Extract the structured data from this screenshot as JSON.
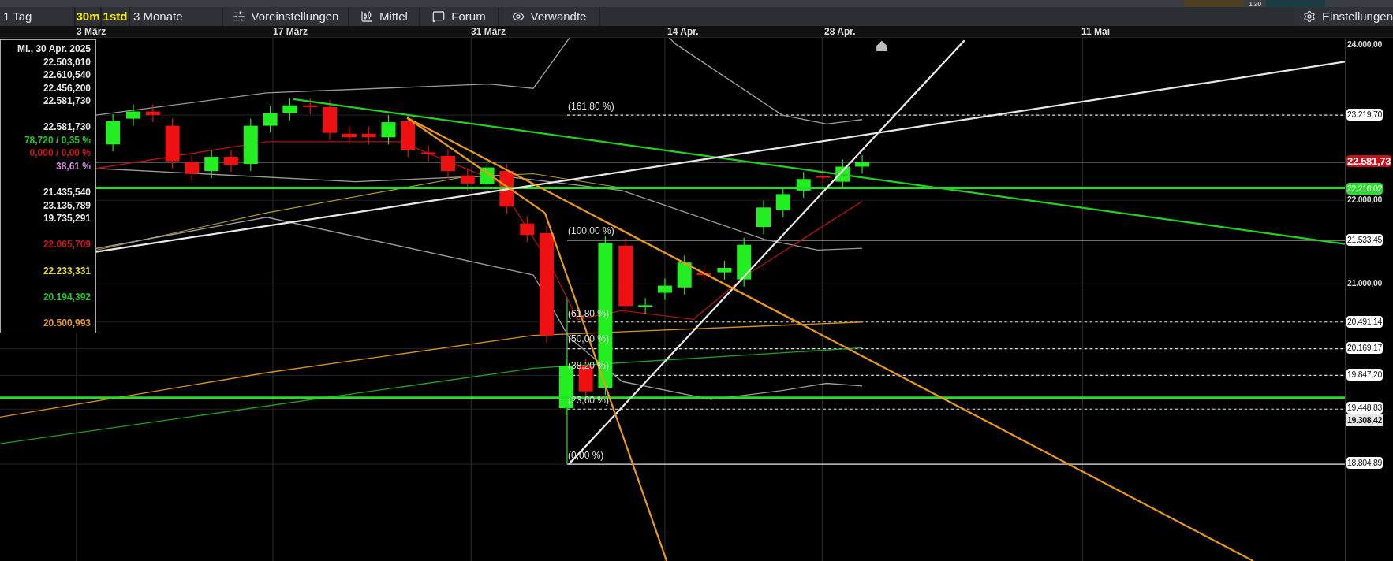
{
  "top_strip": {
    "value": "1,20"
  },
  "toolbar": {
    "items": [
      {
        "label": "1 Tag",
        "kind": "range"
      },
      {
        "label": "30m",
        "kind": "interval"
      },
      {
        "label": "1std",
        "kind": "interval"
      },
      {
        "label": "3 Monate",
        "kind": "range"
      },
      {
        "label": "Voreinstellungen",
        "kind": "presets"
      },
      {
        "label": "Mittel",
        "kind": "indicators"
      },
      {
        "label": "Forum",
        "kind": "forum"
      },
      {
        "label": "Verwandte",
        "kind": "related"
      }
    ],
    "settings": {
      "label": "Einstellungen"
    }
  },
  "date_axis": {
    "labels": [
      "3 März",
      "17 März",
      "31 März",
      "14 Apr.",
      "28 Apr.",
      "11 Mai"
    ]
  },
  "info_box": {
    "groups": [
      [
        {
          "text": "Mi., 30 Apr. 2025",
          "kind": "price"
        },
        {
          "text": "22.503,010",
          "kind": "price"
        },
        {
          "text": "22.610,540",
          "kind": "price"
        },
        {
          "text": "22.456,200",
          "kind": "price"
        },
        {
          "text": "22.581,730",
          "kind": "price"
        }
      ],
      [
        {
          "text": "22.581,730",
          "kind": "price"
        },
        {
          "text": "78,720 / 0,35 %",
          "kind": "up"
        },
        {
          "text": "0,000 / 0,00 %",
          "kind": "down"
        },
        {
          "text": "38,61 %",
          "kind": "pct"
        }
      ],
      [
        {
          "text": "21.435,540",
          "kind": "price"
        },
        {
          "text": "23.135,789",
          "kind": "price"
        },
        {
          "text": "19.735,291",
          "kind": "price"
        }
      ],
      [
        {
          "text": "22.065,709",
          "kind": "red"
        }
      ],
      [
        {
          "text": "22.233,331",
          "kind": "yellow"
        }
      ],
      [
        {
          "text": "20.194,392",
          "kind": "green"
        }
      ],
      [
        {
          "text": "20.500,993",
          "kind": "orange"
        }
      ]
    ]
  },
  "fib_labels": [
    "(161,80 %)",
    "(100,00 %)",
    "(61,80 %)",
    "(50,00 %)",
    "(38,20 %)",
    "(23,60 %)",
    "(0,00 %)"
  ],
  "price_axis": {
    "labels": [
      {
        "text": "24.000,00",
        "kind": "tick"
      },
      {
        "text": "23.219,70",
        "kind": "level"
      },
      {
        "text": "22.581,73",
        "kind": "current"
      },
      {
        "text": "22.218,02",
        "kind": "support"
      },
      {
        "text": "22.000,00",
        "kind": "tick"
      },
      {
        "text": "21.533,45",
        "kind": "level"
      },
      {
        "text": "21.000,00",
        "kind": "tick"
      },
      {
        "text": "20.491,14",
        "kind": "level"
      },
      {
        "text": "20.169,17",
        "kind": "level"
      },
      {
        "text": "19.847,20",
        "kind": "level"
      },
      {
        "text": "19.448,83",
        "kind": "level"
      },
      {
        "text": "19.308,42",
        "kind": "low"
      },
      {
        "text": "18.804,89",
        "kind": "level"
      }
    ]
  }
}
